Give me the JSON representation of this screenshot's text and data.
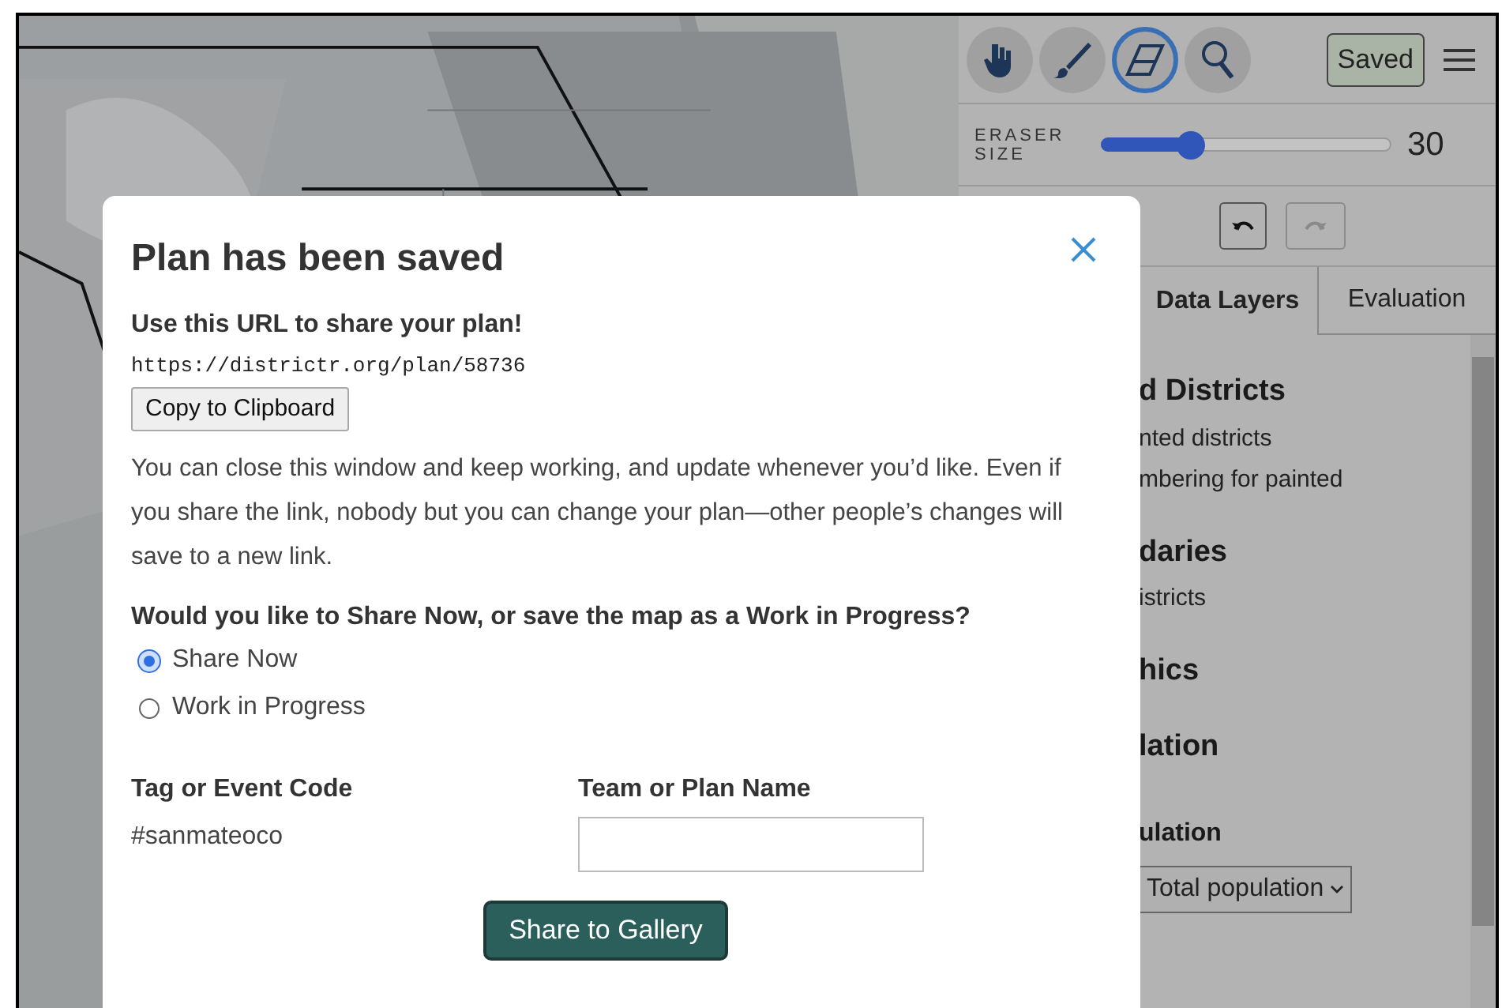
{
  "toolbar": {
    "tools": [
      {
        "kind": "hand",
        "selected": false
      },
      {
        "kind": "brush",
        "selected": false
      },
      {
        "kind": "eraser",
        "selected": true
      },
      {
        "kind": "search",
        "selected": false
      }
    ],
    "saved_button": "Saved"
  },
  "brush_size": {
    "label": "ERASER SIZE",
    "level": 0.31,
    "reading": "30"
  },
  "history": {
    "undo": {
      "disabled": false
    },
    "redo": {
      "disabled": true
    }
  },
  "tabs": [
    {
      "label": "Data Layers",
      "selected": true
    },
    {
      "label": "Evaluation",
      "selected": false
    }
  ],
  "panel_items": [
    {
      "kind": "heading",
      "text": "d Districts"
    },
    {
      "kind": "text",
      "text": "nted districts"
    },
    {
      "kind": "text",
      "text": "mbering for painted"
    },
    {
      "kind": "heading",
      "text": "daries"
    },
    {
      "kind": "text",
      "text": "istricts"
    },
    {
      "kind": "heading",
      "text": "hics"
    },
    {
      "kind": "heading",
      "text": "lation"
    },
    {
      "kind": "subheading",
      "text": "ulation"
    },
    {
      "kind": "select",
      "text": "Total population"
    }
  ],
  "dialog": {
    "title": "Plan has been saved",
    "url_label": "Use this URL to share your plan!",
    "url": "https://districtr.org/plan/58736",
    "copy_button": "Copy to Clipboard",
    "message": "You can close this window and keep working, and update whenever you’d like. Even if you share the link, nobody but you can change your plan—other people’s changes will save to a new link.",
    "question": "Would you like to Share Now, or save the map as a Work in Progress?",
    "options": [
      {
        "label": "Share Now",
        "selected": true
      },
      {
        "label": "Work in Progress",
        "selected": false
      }
    ],
    "tag_label": "Tag or Event Code",
    "tag_value": "#sanmateoco",
    "name_label": "Team or Plan Name",
    "share_button": "Share to Gallery"
  }
}
